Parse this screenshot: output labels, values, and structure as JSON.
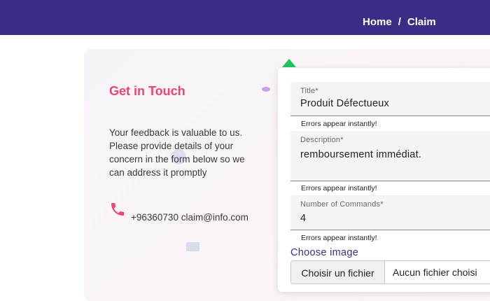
{
  "header": {
    "breadcrumb": {
      "home": "Home",
      "separator": "/",
      "current": "Claim"
    },
    "background_color": "#3b2c85"
  },
  "contact_panel": {
    "title": "Get in Touch",
    "description": "Your feedback is valuable to us. Please provide details of your concern in the form below so we can address it promptly",
    "phone_icon": "phone-icon",
    "contact_line": "+96360730 claim@info.com",
    "accent_color": "#f0456a"
  },
  "form": {
    "title_field": {
      "label": "Title*",
      "value": "Produit Défectueux",
      "helper": "Errors appear instantly!"
    },
    "description_field": {
      "label": "Description*",
      "value": "remboursement immédiat.",
      "helper": "Errors appear instantly!"
    },
    "commands_field": {
      "label": "Number of Commands*",
      "value": "4",
      "helper": "Errors appear instantly!"
    },
    "image": {
      "label": "Choose image",
      "button": "Choisir un fichier",
      "status": "Aucun fichier choisi"
    }
  }
}
